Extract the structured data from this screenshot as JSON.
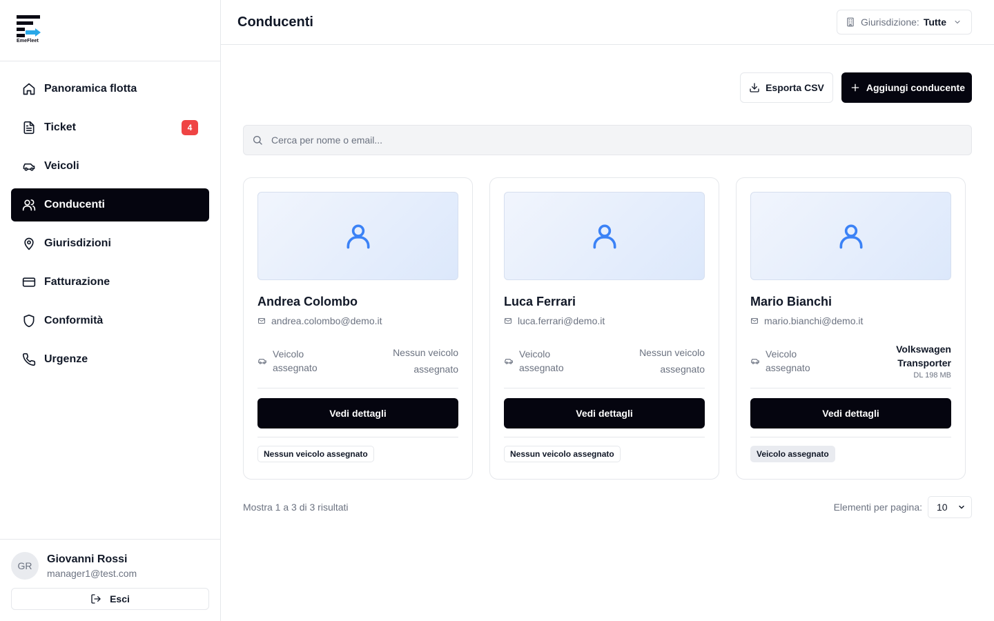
{
  "brand": {
    "name": "EmeFleet"
  },
  "header": {
    "title": "Conducenti",
    "jurisdiction_label": "Giurisdizione:",
    "jurisdiction_value": "Tutte"
  },
  "sidebar": {
    "items": [
      {
        "label": "Panoramica flotta",
        "icon": "home-icon"
      },
      {
        "label": "Ticket",
        "icon": "document-icon",
        "badge": "4"
      },
      {
        "label": "Veicoli",
        "icon": "car-icon"
      },
      {
        "label": "Conducenti",
        "icon": "users-icon",
        "active": true
      },
      {
        "label": "Giurisdizioni",
        "icon": "map-pin-icon"
      },
      {
        "label": "Fatturazione",
        "icon": "credit-card-icon"
      },
      {
        "label": "Conformità",
        "icon": "shield-icon"
      },
      {
        "label": "Urgenze",
        "icon": "phone-icon"
      }
    ]
  },
  "user": {
    "initials": "GR",
    "name": "Giovanni Rossi",
    "email": "manager1@test.com",
    "logout_label": "Esci"
  },
  "toolbar": {
    "export_label": "Esporta CSV",
    "add_label": "Aggiungi conducente"
  },
  "search": {
    "placeholder": "Cerca per nome o email..."
  },
  "drivers": [
    {
      "name": "Andrea Colombo",
      "email": "andrea.colombo@demo.it",
      "vehicle_label": "Veicolo assegnato",
      "vehicle_value": "Nessun veicolo assegnato",
      "plate": "",
      "button": "Vedi dettagli",
      "status": "Nessun veicolo assegnato"
    },
    {
      "name": "Luca Ferrari",
      "email": "luca.ferrari@demo.it",
      "vehicle_label": "Veicolo assegnato",
      "vehicle_value": "Nessun veicolo assegnato",
      "plate": "",
      "button": "Vedi dettagli",
      "status": "Nessun veicolo assegnato"
    },
    {
      "name": "Mario Bianchi",
      "email": "mario.bianchi@demo.it",
      "vehicle_label": "Veicolo assegnato",
      "vehicle_value": "Volkswagen Transporter",
      "plate": "DL 198 MB",
      "button": "Vedi dettagli",
      "status": "Veicolo assegnato"
    }
  ],
  "pagination": {
    "info": "Mostra 1 a 3 di 3 risultati",
    "per_page_label": "Elementi per pagina:",
    "per_page_value": "10"
  },
  "colors": {
    "accent": "#05050f",
    "badge": "#ef4444",
    "avatar_icon": "#3b82f6"
  }
}
